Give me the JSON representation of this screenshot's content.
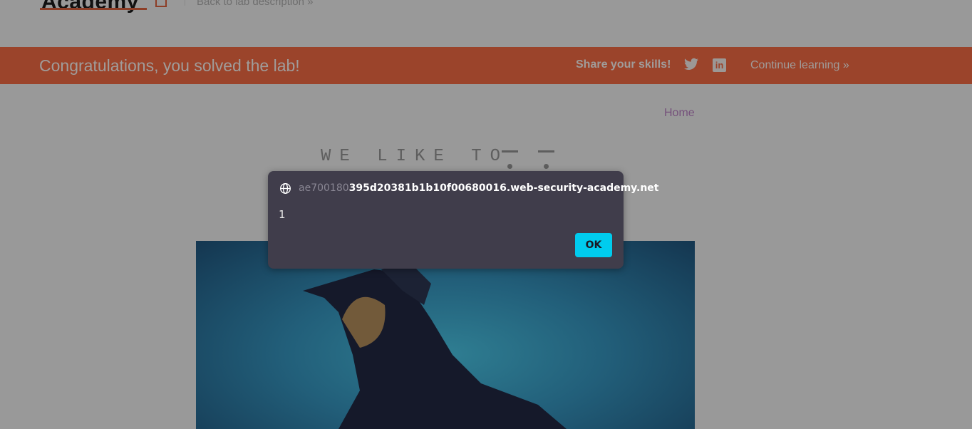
{
  "header": {
    "logo_text": "Academy",
    "back_link": "Back to lab description »"
  },
  "banner": {
    "message": "Congratulations, you solved the lab!",
    "share_label": "Share your skills!",
    "continue_label": "Continue learning »",
    "linkedin_glyph": "in",
    "color": "#9b442b"
  },
  "nav": {
    "home": "Home"
  },
  "blog": {
    "slogan": "WE LIKE TO"
  },
  "dialog": {
    "origin_faded": "ae700180",
    "origin_main": "395d20381b1b10f00680016.web-security-academy.net",
    "message": "1",
    "ok_label": "OK"
  }
}
